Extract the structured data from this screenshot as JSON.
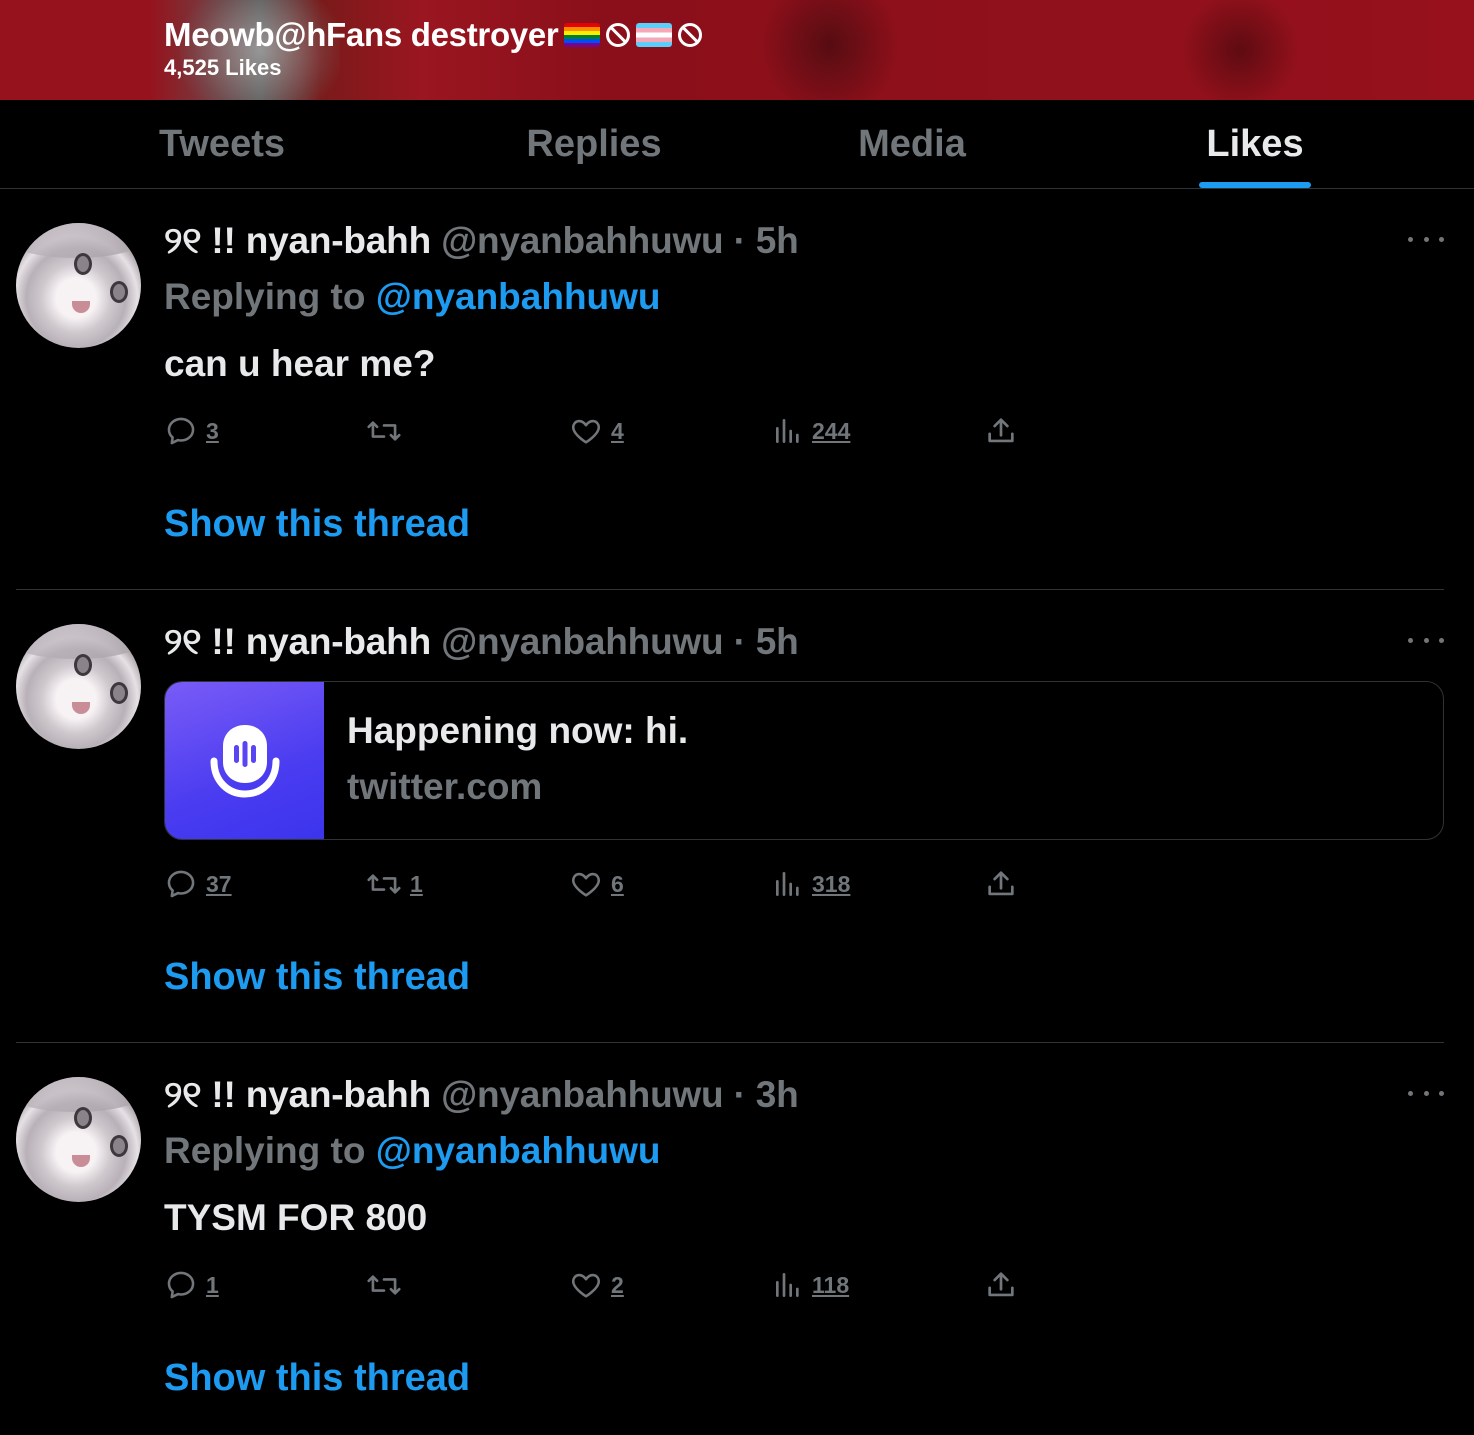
{
  "header": {
    "name": "Meowb@hFans destroyer",
    "likes_count": "4,525 Likes",
    "badges": [
      "rainbow-flag",
      "prohibited-sign",
      "transgender-flag",
      "prohibited-sign"
    ]
  },
  "tabs": [
    {
      "label": "Tweets",
      "active": false
    },
    {
      "label": "Replies",
      "active": false
    },
    {
      "label": "Media",
      "active": false
    },
    {
      "label": "Likes",
      "active": true
    }
  ],
  "colors": {
    "accent": "#1d9bf0",
    "header_bg": "#96131d",
    "muted": "#71767b",
    "text": "#e7e9ea"
  },
  "tweets": [
    {
      "display_name": "୨୧ !! nyan-bahh",
      "handle": "@nyanbahhuwu",
      "time": "· 5h",
      "replying_label": "Replying to ",
      "replying_to": "@nyanbahhuwu",
      "text": "can u hear me?",
      "replies": "3",
      "retweets": "",
      "likes": "4",
      "views": "244",
      "show_thread": "Show this thread"
    },
    {
      "display_name": "୨୧ !! nyan-bahh",
      "handle": "@nyanbahhuwu",
      "time": "· 5h",
      "card": {
        "title": "Happening now: hi.",
        "domain": "twitter.com",
        "icon": "spaces-microphone-icon"
      },
      "replies": "37",
      "retweets": "1",
      "likes": "6",
      "views": "318",
      "show_thread": "Show this thread"
    },
    {
      "display_name": "୨୧ !! nyan-bahh",
      "handle": "@nyanbahhuwu",
      "time": "· 3h",
      "replying_label": "Replying to ",
      "replying_to": "@nyanbahhuwu",
      "text": "TYSM FOR 800",
      "replies": "1",
      "retweets": "",
      "likes": "2",
      "views": "118",
      "show_thread": "Show this thread"
    }
  ]
}
